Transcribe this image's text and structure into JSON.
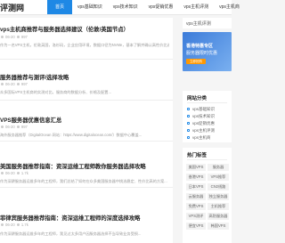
{
  "header": {
    "logo": "评测网",
    "nav": [
      "首页",
      "vps基础知识",
      "vps技术知识",
      "vps促销优惠",
      "vps主机评测",
      "vps主机商"
    ]
  },
  "articles": [
    {
      "title": "vps主机商推荐与服务器选择建议（伦敦/英国节点）",
      "date": "06-20",
      "views": "997",
      "excerpt": "作为一名VPS主机，伦敦英国，洛杉矶，企业应用环境，数据口径为NVMe，基本了解并确认高性价比选择..."
    },
    {
      "title": "服务器推荐与测评/选择攻略",
      "date": "06-20",
      "views": "997",
      "excerpt": "众多国际VPS主机商的实测对比，服务商的数据分析、价格及配置..."
    },
    {
      "title": "VPS服务器优惠信息汇总",
      "date": "06-20",
      "views": "997",
      "excerpt": "海外服务器推荐（DigitalOcean 网站：https://www.digitalocean.com/）数据中心覆盖..."
    },
    {
      "title": "美国服务器推荐指南：资深运维工程师教你服务器选择攻略",
      "date": "06-20",
      "views": "1.7k",
      "excerpt": "作为深耕服务器运维多年的工程师，我们总结了如何在众多美国服务器中挑选稳定、性价比高的方案..."
    },
    {
      "title": "菲律宾服务器推荐指南：资深运维工程师的深度选择攻略",
      "date": "06-20",
      "views": "1.7k",
      "excerpt": "作为深耕服务器运维多年的工程师，我见过太多用户因服务器选择不当导致业务受损..."
    }
  ],
  "sidebar": {
    "top_text": "vps主机评测",
    "banner": {
      "line1": "香港特惠专区",
      "line2": "服务器限时优惠",
      "button": "立即抢购"
    },
    "categories_title": "网站分类",
    "categories": [
      "vps基础知识",
      "vps技术知识",
      "vps促销优惠",
      "vps主机评测",
      "vps主机商"
    ],
    "tags_title": "热门标签",
    "tags": [
      "美国VPS",
      "服务器",
      "香港VPS",
      "VPS推荐",
      "日本VPS",
      "CN2线路",
      "云服务器",
      "独立服务器",
      "免费VPS",
      "主机推荐",
      "VPS测评",
      "高防服务器",
      "便宜VPS",
      "韩国VPS"
    ]
  }
}
